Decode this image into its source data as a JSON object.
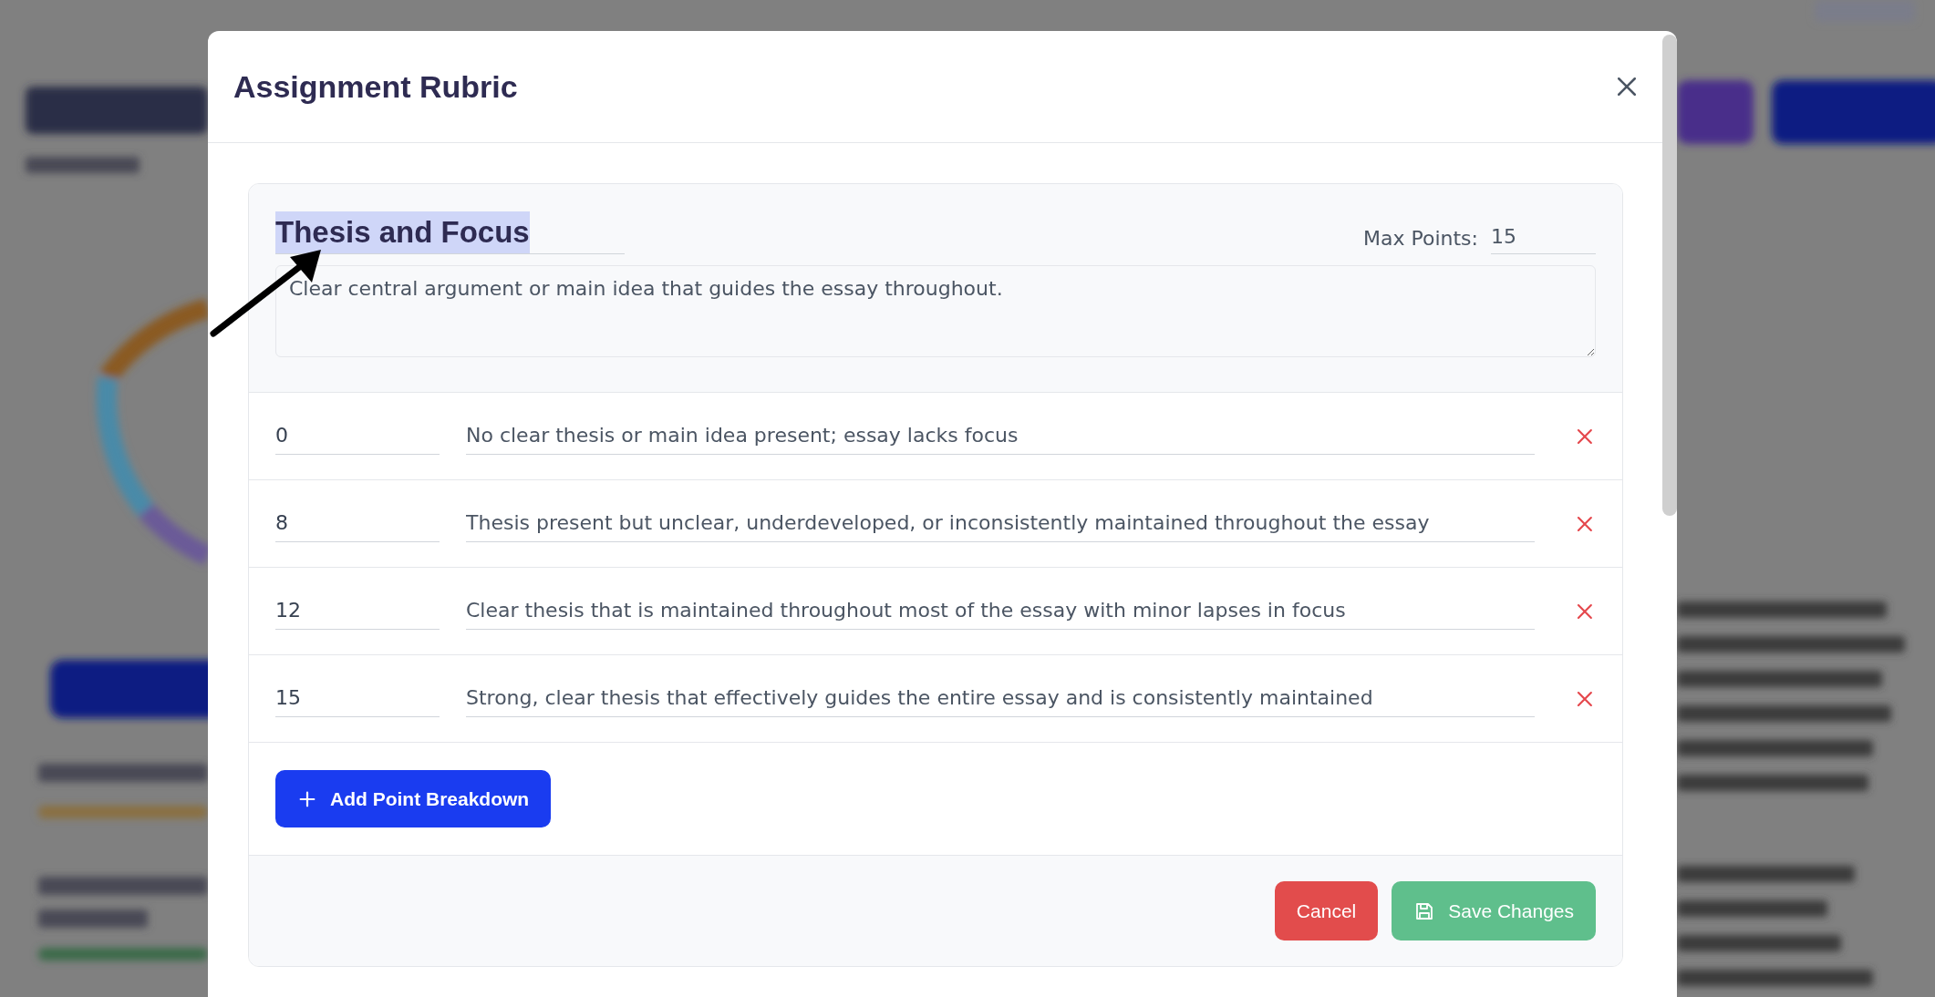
{
  "dialog": {
    "title": "Assignment Rubric"
  },
  "criterion": {
    "name": "Thesis and Focus",
    "max_points_label": "Max Points:",
    "max_points": "15",
    "description": "Clear central argument or main idea that guides the essay throughout."
  },
  "breakdowns": [
    {
      "points": "0",
      "description": "No clear thesis or main idea present; essay lacks focus"
    },
    {
      "points": "8",
      "description": "Thesis present but unclear, underdeveloped, or inconsistently maintained throughout the essay"
    },
    {
      "points": "12",
      "description": "Clear thesis that is maintained throughout most of the essay with minor lapses in focus"
    },
    {
      "points": "15",
      "description": "Strong, clear thesis that effectively guides the entire essay and is consistently maintained"
    }
  ],
  "add_button": "Add Point Breakdown",
  "buttons": {
    "cancel": "Cancel",
    "save": "Save Changes"
  }
}
